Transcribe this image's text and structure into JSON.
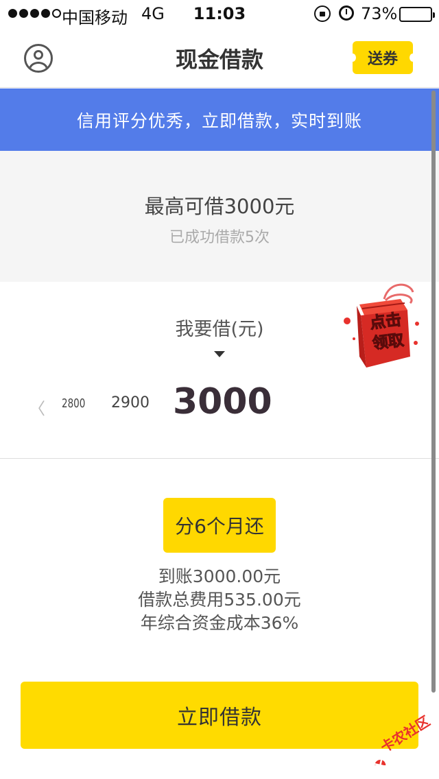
{
  "status_bar": {
    "carrier": "中国移动",
    "network": "4G",
    "time": "11:03",
    "battery": "73%",
    "battery_level": 0.73,
    "icons": [
      "signal-dots",
      "rotation-lock-icon",
      "alarm-icon",
      "battery-icon"
    ]
  },
  "nav": {
    "title": "现金借款",
    "coupon_label": "送券",
    "left_icon": "user-icon"
  },
  "banner": {
    "text": "信用评分优秀，立即借款，实时到账"
  },
  "credit": {
    "max_amount": "最高可借3000元",
    "success_count": "已成功借款5次"
  },
  "selector": {
    "label": "我要借(元)",
    "prev_chevron": "〈",
    "options": [
      "2800",
      "2900"
    ],
    "selected": "3000"
  },
  "gift": {
    "line1": "点击",
    "line2": "领取"
  },
  "installment": {
    "label": "分6个月还"
  },
  "details": {
    "received": "到账3000.00元",
    "total_fee": "借款总费用535.00元",
    "annual_cost": "年综合资金成本36%"
  },
  "actions": {
    "borrow_label": "立即借款"
  },
  "watermark": {
    "text": "卡农社区"
  },
  "colors": {
    "accent_yellow": "#ffd800",
    "banner_blue": "#537ce9",
    "gift_red": "#e8322d"
  }
}
